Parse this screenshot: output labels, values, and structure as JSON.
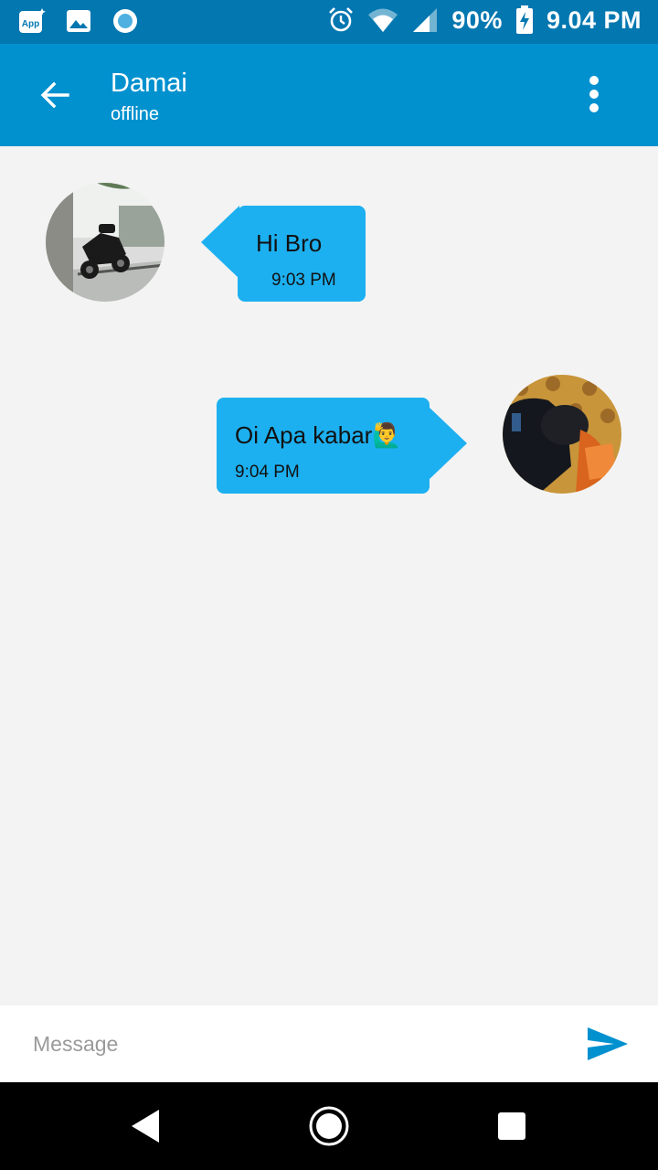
{
  "status_bar": {
    "left_icons": [
      "app-icon",
      "image-icon",
      "circle-icon"
    ],
    "battery": "90%",
    "time": "9.04 PM"
  },
  "app_bar": {
    "title": "Damai",
    "subtitle": "offline"
  },
  "messages": [
    {
      "direction": "incoming",
      "text": "Hi Bro",
      "time": "9:03 PM"
    },
    {
      "direction": "outgoing",
      "text": "Oi Apa kabar🙋‍♂️",
      "time": "9:04 PM"
    }
  ],
  "input": {
    "placeholder": "Message",
    "value": ""
  },
  "colors": {
    "status_bar": "#0277b0",
    "app_bar": "#0291cf",
    "bubble": "#1db0f0",
    "send": "#0291cf"
  }
}
